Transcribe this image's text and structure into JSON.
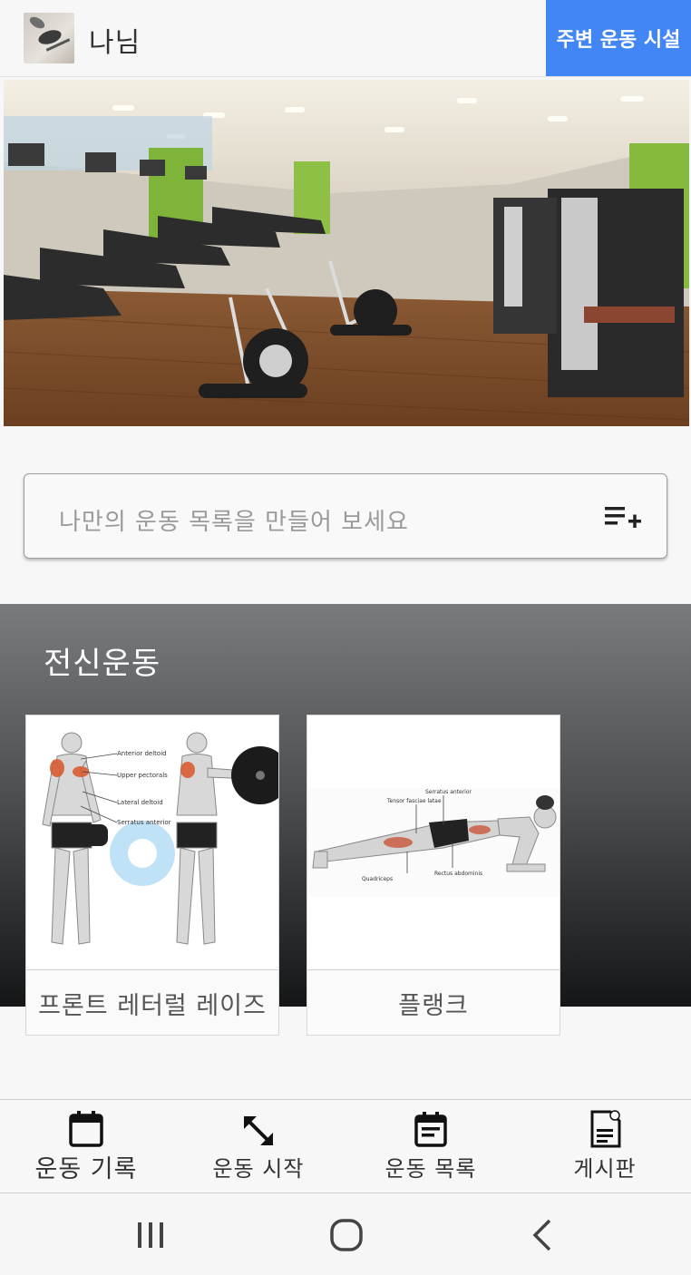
{
  "header": {
    "username": "나님",
    "nearby_button": "주변 운동 시설"
  },
  "hero": {
    "alt": "gym interior photo"
  },
  "custom_list": {
    "placeholder": "나만의 운동 목록을 만들어 보세요",
    "icon": "playlist-add-icon"
  },
  "section": {
    "title": "전신운동",
    "cards": [
      {
        "label": "프론트 레터럴 레이즈",
        "image": "front-lateral-raise-illustration"
      },
      {
        "label": "플랭크",
        "image": "plank-illustration"
      }
    ]
  },
  "bottom_nav": {
    "items": [
      {
        "label": "운동 기록",
        "icon": "calendar-icon"
      },
      {
        "label": "운동 시작",
        "icon": "expand-arrows-icon"
      },
      {
        "label": "운동 목록",
        "icon": "event-note-icon"
      },
      {
        "label": "게시판",
        "icon": "document-icon"
      }
    ]
  },
  "system_nav": {
    "items": [
      "recent-apps-icon",
      "home-icon",
      "back-icon"
    ]
  },
  "colors": {
    "accent": "#4285f4",
    "section_gradient_top": "#797b7d",
    "section_gradient_bottom": "#151617"
  }
}
